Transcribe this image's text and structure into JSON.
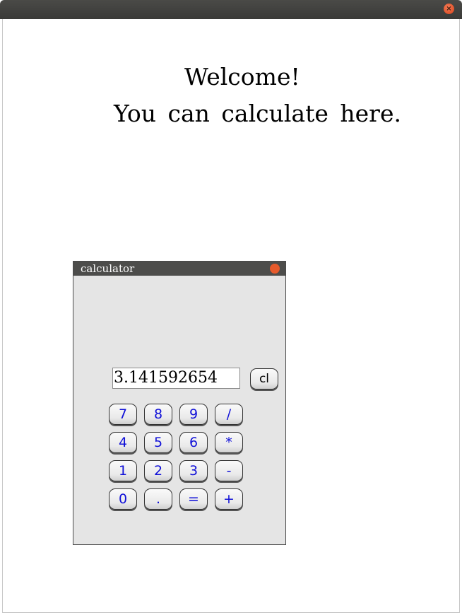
{
  "window": {
    "close_icon": "close-icon",
    "close_glyph": "×"
  },
  "main": {
    "welcome_line1": "Welcome!",
    "welcome_line2": "You can calculate here."
  },
  "calculator": {
    "title": "calculator",
    "display_value": "3.141592654",
    "clear_label": "cl",
    "keys": [
      "7",
      "8",
      "9",
      "/",
      "4",
      "5",
      "6",
      "*",
      "1",
      "2",
      "3",
      "-",
      "0",
      ".",
      "=",
      "+"
    ]
  },
  "colors": {
    "titlebar": "#3f3f3d",
    "close": "#e65a2c",
    "calc_bg": "#e5e5e5",
    "key_text": "#1010d8"
  }
}
